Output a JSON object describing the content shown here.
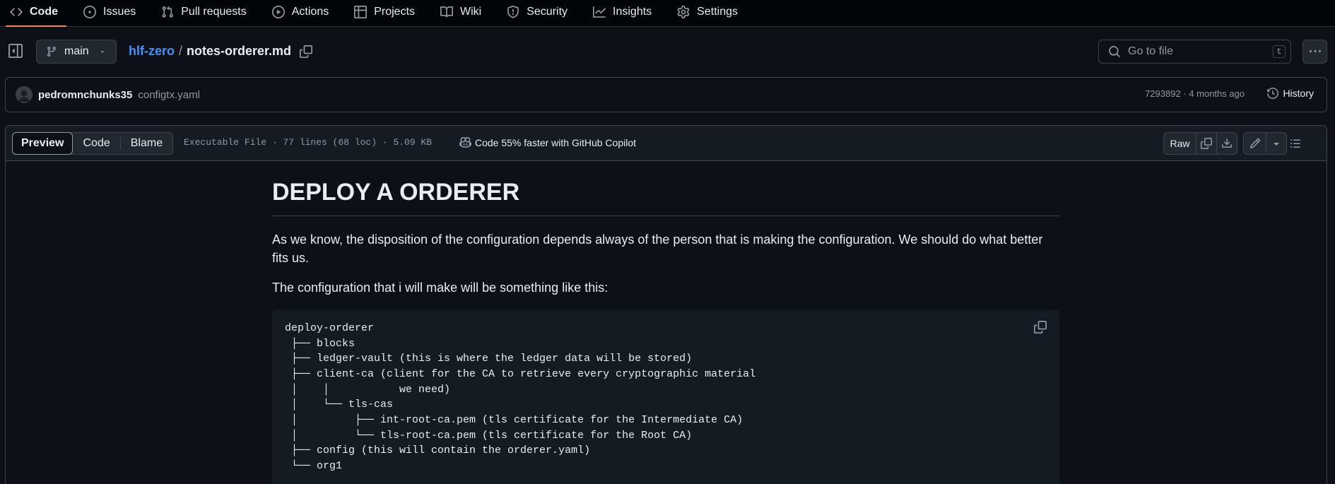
{
  "nav": {
    "tabs": [
      {
        "label": "Code",
        "icon": "code-icon",
        "active": true
      },
      {
        "label": "Issues",
        "icon": "issue-opened-icon"
      },
      {
        "label": "Pull requests",
        "icon": "git-pull-request-icon"
      },
      {
        "label": "Actions",
        "icon": "play-icon"
      },
      {
        "label": "Projects",
        "icon": "table-icon"
      },
      {
        "label": "Wiki",
        "icon": "book-icon"
      },
      {
        "label": "Security",
        "icon": "shield-icon"
      },
      {
        "label": "Insights",
        "icon": "graph-icon"
      },
      {
        "label": "Settings",
        "icon": "gear-icon"
      }
    ]
  },
  "file_header": {
    "branch": "main",
    "repo": "hlf-zero",
    "separator": "/",
    "filename": "notes-orderer.md",
    "goto_placeholder": "Go to file",
    "goto_shortcut": "t"
  },
  "commit": {
    "author": "pedromnchunks35",
    "message": "configtx.yaml",
    "meta": "7293892 · 4 months ago",
    "history_label": "History"
  },
  "viewer": {
    "tabs": [
      "Preview",
      "Code",
      "Blame"
    ],
    "active_tab": "Preview",
    "file_info": "Executable File · 77 lines (68 loc) · 5.09 KB",
    "copilot_text": "Code 55% faster with GitHub Copilot",
    "raw_label": "Raw"
  },
  "markdown": {
    "heading": "DEPLOY A ORDERER",
    "paragraph1": "As we know, the disposition of the configuration depends always of the person that is making the configuration. We should do what better fits us.",
    "paragraph2": "The configuration that i will make will be something like this:",
    "code": "deploy-orderer\n ├── blocks\n ├── ledger-vault (this is where the ledger data will be stored)\n ├── client-ca (client for the CA to retrieve every cryptographic material\n │    │           we need)\n │    └── tls-cas\n │         ├── int-root-ca.pem (tls certificate for the Intermediate CA)\n │         └── tls-root-ca.pem (tls certificate for the Root CA)\n ├── config (this will contain the orderer.yaml)\n └── org1"
  },
  "colors": {
    "background": "#0d1117",
    "link": "#4493f8",
    "active_tab_underline": "#f78166",
    "border": "#3d444d"
  }
}
